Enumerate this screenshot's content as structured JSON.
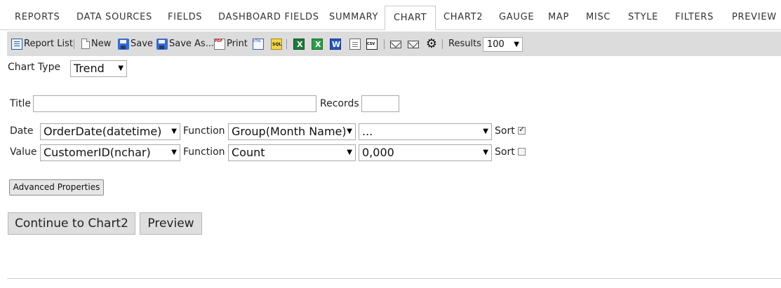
{
  "tabs": [
    {
      "label": "REPORTS"
    },
    {
      "label": "DATA SOURCES"
    },
    {
      "label": "FIELDS"
    },
    {
      "label": "DASHBOARD FIELDS"
    },
    {
      "label": "SUMMARY"
    },
    {
      "label": "CHART",
      "active": true
    },
    {
      "label": "CHART2"
    },
    {
      "label": "GAUGE"
    },
    {
      "label": "MAP"
    },
    {
      "label": "MISC"
    },
    {
      "label": "STYLE"
    },
    {
      "label": "FILTERS"
    },
    {
      "label": "PREVIEW"
    }
  ],
  "toolbar": {
    "report_list": "Report List",
    "new": "New",
    "save": "Save",
    "save_as": "Save As...",
    "print": "Print",
    "results_label": "Results",
    "results_value": "100",
    "icons": [
      "list-icon",
      "new-page-icon",
      "save-disk-icon",
      "save-as-disk-icon",
      "pdf-print-icon",
      "html-export-icon",
      "sql-icon",
      "excel-icon",
      "excel-alt-icon",
      "word-icon",
      "document-icon",
      "csv-icon",
      "email-icon",
      "email-alt-icon",
      "gear-icon"
    ]
  },
  "form": {
    "chart_type_label": "Chart Type",
    "chart_type_value": "Trend",
    "title_label": "Title",
    "title_value": "",
    "records_label": "Records",
    "records_value": "",
    "date_label": "Date",
    "date_field": "OrderDate(datetime)",
    "function_label": "Function",
    "date_function": "Group(Month Name)",
    "date_format": "...",
    "sort_label": "Sort",
    "date_sort_checked": true,
    "value_label": "Value",
    "value_field": "CustomerID(nchar)",
    "value_function": "Count",
    "value_format": "0,000",
    "value_sort_checked": false,
    "advanced_button": "Advanced Properties",
    "continue_button": "Continue to Chart2",
    "preview_button": "Preview"
  }
}
